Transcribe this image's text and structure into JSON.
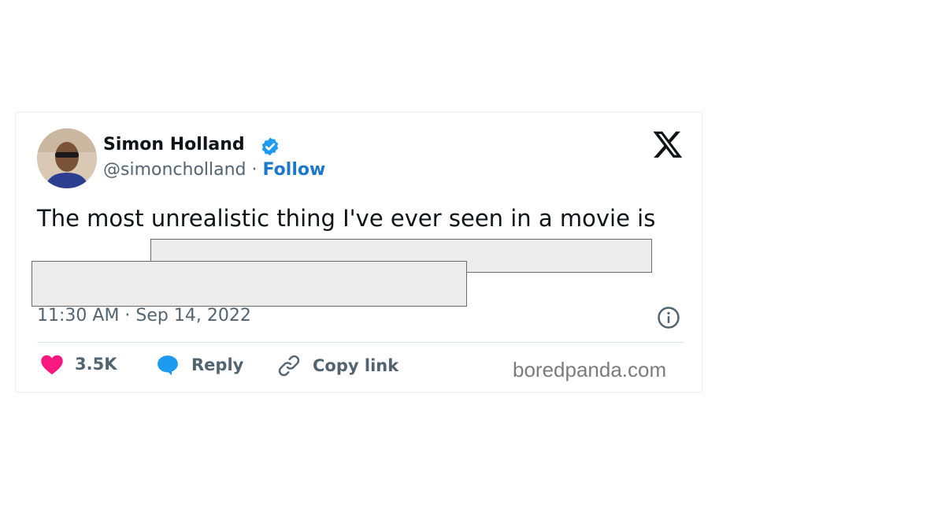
{
  "tweet": {
    "author_name": "Simon Holland",
    "handle": "@simoncholland",
    "separator": "·",
    "follow_label": "Follow",
    "text": "The most unrealistic thing I've ever seen in a movie is",
    "timestamp": "11:30 AM · Sep 14, 2022"
  },
  "actions": {
    "likes_count": "3.5K",
    "reply_label": "Reply",
    "copy_link_label": "Copy link"
  },
  "watermark": "boredpanda.com",
  "colors": {
    "verified": "#1d9bf0",
    "follow": "#1d78c9",
    "like": "#f91880",
    "reply": "#1d9bf0",
    "redaction_fill": "#ececec"
  },
  "icons": {
    "verified": "verified-badge-icon",
    "brand": "x-logo-icon",
    "info": "info-icon",
    "like": "heart-icon",
    "reply": "speech-bubble-icon",
    "copy": "link-icon"
  }
}
